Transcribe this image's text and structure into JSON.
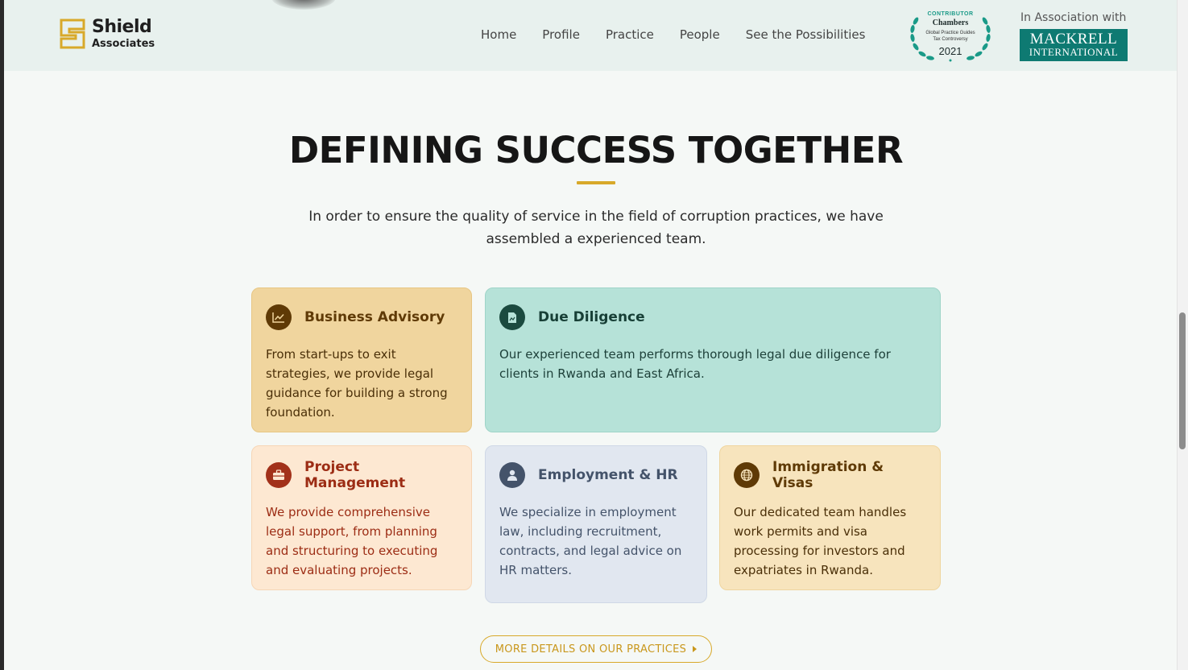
{
  "header": {
    "logo": {
      "name": "Shield",
      "sub": "Associates"
    },
    "nav": [
      {
        "label": "Home"
      },
      {
        "label": "Profile"
      },
      {
        "label": "Practice"
      },
      {
        "label": "People"
      },
      {
        "label": "See the Possibilities"
      }
    ],
    "badge": {
      "contributor": "CONTRIBUTOR",
      "brand": "Chambers",
      "line1": "Global Practice Guides",
      "line2": "Tax Controversy",
      "year": "2021"
    },
    "association": {
      "label": "In Association with",
      "partner_line1": "MACKRELL",
      "partner_line2": "INTERNATIONAL"
    }
  },
  "main": {
    "title": "DEFINING SUCCESS TOGETHER",
    "intro": "In order to ensure the quality of service in the field of corruption practices, we have assembled a experienced team.",
    "cards": [
      {
        "icon": "chart-icon",
        "title": "Business Advisory",
        "body": "From start-ups to exit strategies, we provide legal guidance for building a strong foundation."
      },
      {
        "icon": "document-icon",
        "title": "Due Diligence",
        "body": "Our experienced team performs thorough legal due diligence for clients in Rwanda and East Africa."
      },
      {
        "icon": "briefcase-icon",
        "title": "Project Management",
        "body": "We provide comprehensive legal support, from planning and structuring to executing and evaluating projects."
      },
      {
        "icon": "person-icon",
        "title": "Employment & HR",
        "body": "We specialize in employment law, including recruitment, contracts, and legal advice on HR matters."
      },
      {
        "icon": "globe-icon",
        "title": "Immigration & Visas",
        "body": "Our dedicated team handles work permits and visa processing for investors and expatriates in Rwanda."
      }
    ],
    "more_button": "MORE DETAILS ON OUR PRACTICES"
  },
  "colors": {
    "accent_gold": "#d8a92a",
    "teal_brand": "#0e7a72"
  }
}
